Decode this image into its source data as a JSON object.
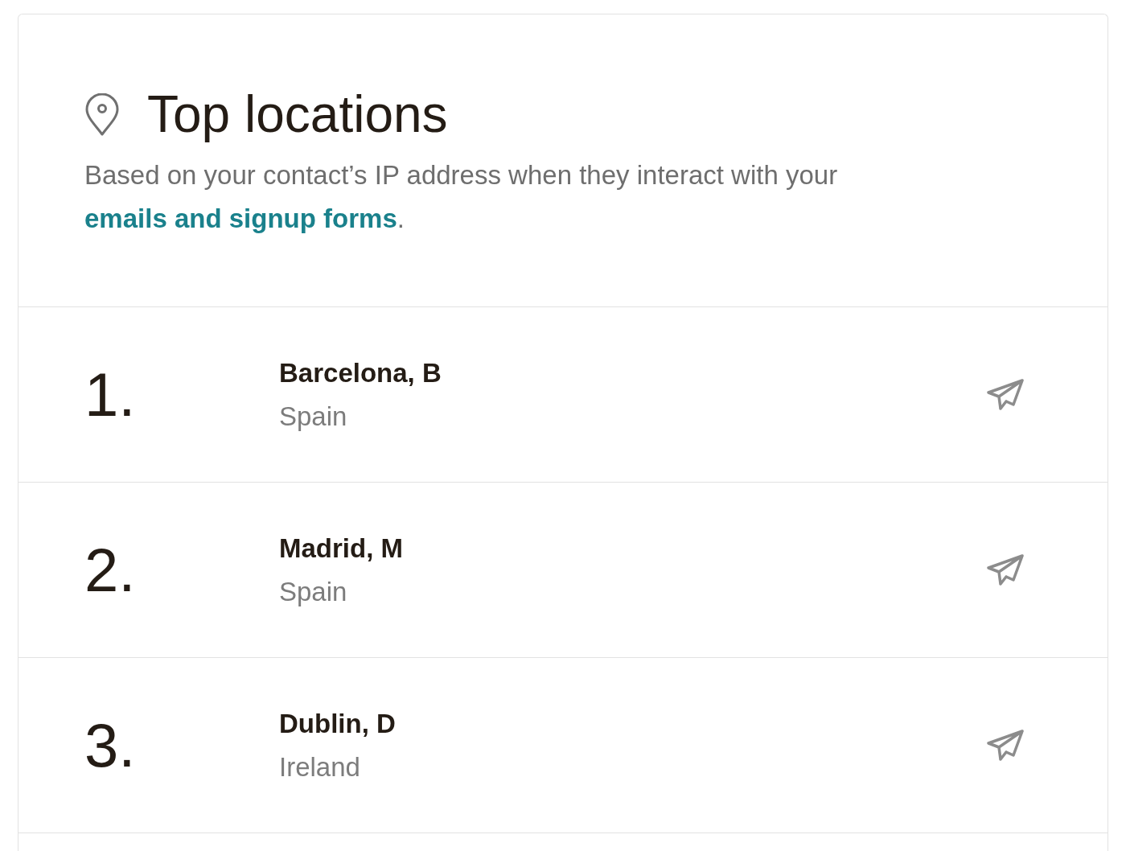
{
  "card": {
    "title": "Top locations",
    "description": {
      "text": "Based on your contact’s IP address when they interact with your",
      "link": "emails and signup forms",
      "end": "."
    },
    "locations": [
      {
        "rank": "1.",
        "city": "Barcelona, B",
        "country": "Spain"
      },
      {
        "rank": "2.",
        "city": "Madrid, M",
        "country": "Spain"
      },
      {
        "rank": "3.",
        "city": "Dublin, D",
        "country": "Ireland"
      }
    ]
  }
}
